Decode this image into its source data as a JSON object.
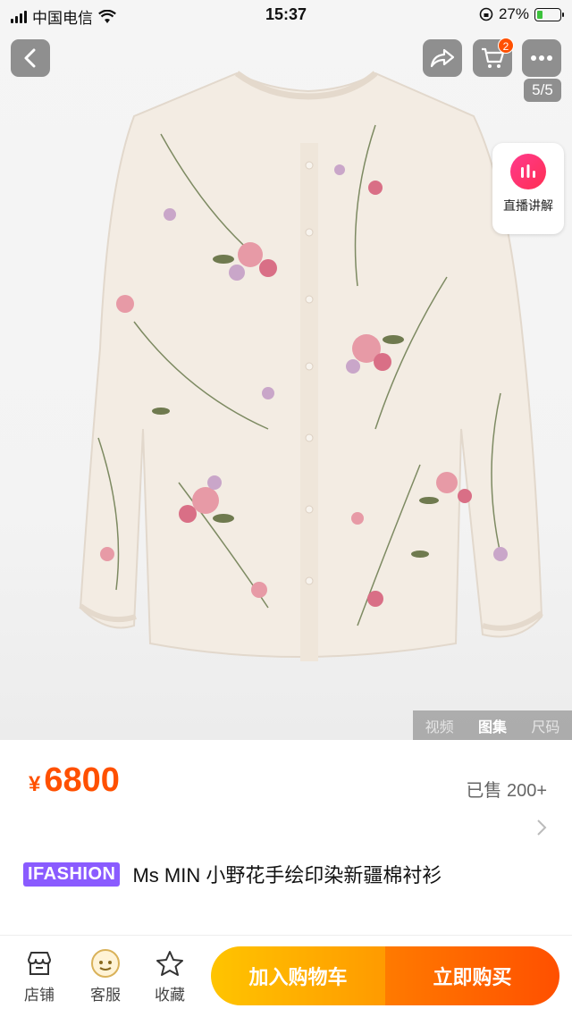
{
  "status_bar": {
    "carrier": "中国电信",
    "time": "15:37",
    "battery": "27%",
    "battery_level": 0.27
  },
  "nav": {
    "cart_count": "2",
    "page_indicator": "5/5"
  },
  "live": {
    "label": "直播讲解"
  },
  "media_tabs": {
    "video": "视频",
    "gallery": "图集",
    "size": "尺码"
  },
  "product": {
    "currency": "¥",
    "price": "6800",
    "sold": "已售 200+",
    "brand_tag": "IFASHION",
    "title": "Ms MIN  小野花手绘印染新疆棉衬衫"
  },
  "bottom": {
    "shop": "店铺",
    "service": "客服",
    "favorite": "收藏",
    "add_to_cart": "加入购物车",
    "buy_now": "立即购买"
  },
  "colors": {
    "accent": "#ff5000",
    "cart_button": "#ffb000",
    "brand_tag": "#8a5bff"
  }
}
